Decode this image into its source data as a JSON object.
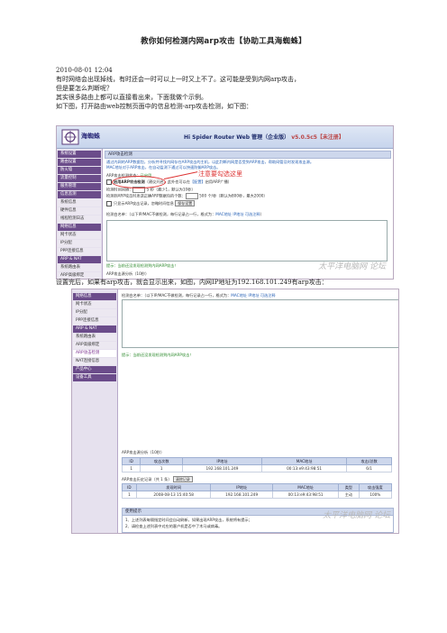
{
  "doc": {
    "title": "教你如何检测内网arp攻击【协助工具海蜘蛛】",
    "paragraphs": [
      "2010-08-01 12:04",
      "有时网络会出现掉线，有时还会一时可以上一时又上不了。这可能是受到内网arp攻击，",
      "但是要怎么判断呢？",
      "其实很多路由上都可以直接看出来，下面我做个示例。",
      "如下图，打开路由web控制页面中的信息检测-arp攻击检测，如下图：",
      "设置完后，如果有arp攻击，就会显示出来，如图，内网IP地址为192.168.101.249有arp攻击："
    ]
  },
  "shot1": {
    "brand": "海蜘蛛",
    "app_title": "Hi Spider Router Web 管理（企业版）",
    "version": "v5.0.5c5【未注册】",
    "menu": [
      {
        "label": "系统设置",
        "kind": "sec"
      },
      {
        "label": "路由设置",
        "kind": "sec"
      },
      {
        "label": "防火墙",
        "kind": "sec"
      },
      {
        "label": "流量控制",
        "kind": "sec"
      },
      {
        "label": "服务管理",
        "kind": "sec"
      },
      {
        "label": "信息监测",
        "kind": "sec"
      },
      {
        "label": "系统信息",
        "kind": "sub"
      },
      {
        "label": "硬件信息",
        "kind": "sub"
      },
      {
        "label": "线程检测日志",
        "kind": "sub"
      },
      {
        "label": "网络信息",
        "kind": "sec"
      },
      {
        "label": "网卡状态",
        "kind": "sub"
      },
      {
        "label": "IP分配",
        "kind": "sub"
      },
      {
        "label": "PPP连接信息",
        "kind": "sub"
      },
      {
        "label": "ARP & NAT",
        "kind": "sec"
      },
      {
        "label": "系统路由表",
        "kind": "sub"
      },
      {
        "label": "ARP高级绑定",
        "kind": "sub"
      },
      {
        "label": "ARP攻击检测",
        "kind": "act"
      },
      {
        "label": "NAT连接信息",
        "kind": "sub"
      }
    ],
    "panel_title": "ARP攻击检测",
    "desc1": "通过内网的ARP数据包，分析并寻找内网存在ARP攻击的主机，以此判断内网是否受到ARP攻击，帮助网管及时发现攻击源。",
    "desc2": "MAC地址对于ARP攻击，在自动监测下通过可以快速防御ARP攻击。",
    "status_label": "ARP攻击检测状态：",
    "status_value": "已启用",
    "enable_label": "启用ARP攻击检测",
    "enable_tail": "（建议开启，此外也可以在",
    "enable_link": "【配置】",
    "enable_tail2": "启用ARP广播）",
    "interval_label": "检测时间间隔：",
    "interval_value": "5",
    "interval_unit": "秒（最少1，默认为10秒）",
    "threshold_label": "检测到ARP攻击时发送正确ARP数据包的个数：",
    "threshold_value": "500",
    "threshold_unit": "个/秒（默认为800秒，最大2000）",
    "only_label": "只显示ARP攻击记录，忽略时间信息",
    "save_label": "保存设置",
    "whitelist_label": "检测白名单：（以下IP/MAC不做检测，每行记录占一行，格式为：",
    "whitelist_fmt1": "MAC地址",
    "whitelist_fmt2": "IP地址",
    "whitelist_fmt3": "可选注释",
    "whitelist_end": "）",
    "tip": "提示：当前还没发现检测到内网ARP攻击！",
    "bottom_label": "ARP攻击源分析（10秒）",
    "annotation": "注意要勾选这里",
    "watermark": "太平洋电脑网 论坛"
  },
  "shot2": {
    "menu": [
      {
        "label": "网络信息",
        "kind": "sec"
      },
      {
        "label": "网卡状态",
        "kind": "sub"
      },
      {
        "label": "IP分配",
        "kind": "sub"
      },
      {
        "label": "PPP连接信息",
        "kind": "sub"
      },
      {
        "label": "ARP & NAT",
        "kind": "sec"
      },
      {
        "label": "系统路由表",
        "kind": "sub"
      },
      {
        "label": "ARP高级绑定",
        "kind": "sub"
      },
      {
        "label": "ARP攻击检测",
        "kind": "act"
      },
      {
        "label": "NAT连接信息",
        "kind": "sub"
      },
      {
        "label": "产品中心",
        "kind": "sec"
      },
      {
        "label": "设备工具",
        "kind": "sec"
      }
    ],
    "whitelist_label": "检测白名单：（以下IP/MAC不做检测，每行记录占一行，格式为：",
    "whitelist_fmt1": "MAC地址",
    "whitelist_fmt2": "IP地址",
    "whitelist_fmt3": "可选注释",
    "tip": "提示：当前还没发现检测到内网ARP攻击！",
    "table1_title": "ARP攻击源分析（10秒）",
    "table1_headers": [
      "ID",
      "攻击次数",
      "IP地址",
      "MAC地址",
      "攻击/总数"
    ],
    "table1_rows": [
      [
        "1",
        "1",
        "192.168.101.249",
        "00:13:e9:43:98:51",
        "6/1"
      ]
    ],
    "table2_title": "ARP攻击历史记录（共 1 条）",
    "table2_clear": "清除记录",
    "table2_headers": [
      "ID",
      "发现时间",
      "IP地址",
      "MAC地址",
      "类型",
      "攻击强度"
    ],
    "table2_rows": [
      [
        "1",
        "2008-08-13 15:40:58",
        "192.168.101.249",
        "00:13:e9:43:98:51",
        "主动",
        "100%"
      ]
    ],
    "help_title": "使用提示",
    "help1": "1、上述列表每隔指定时间会自动刷新，如果出现ARP攻击，系统将有提示；",
    "help2": "2、请检查上述列表中对应的客户机是否中了木马或病毒。",
    "watermark": "太平洋电脑网 论坛"
  }
}
